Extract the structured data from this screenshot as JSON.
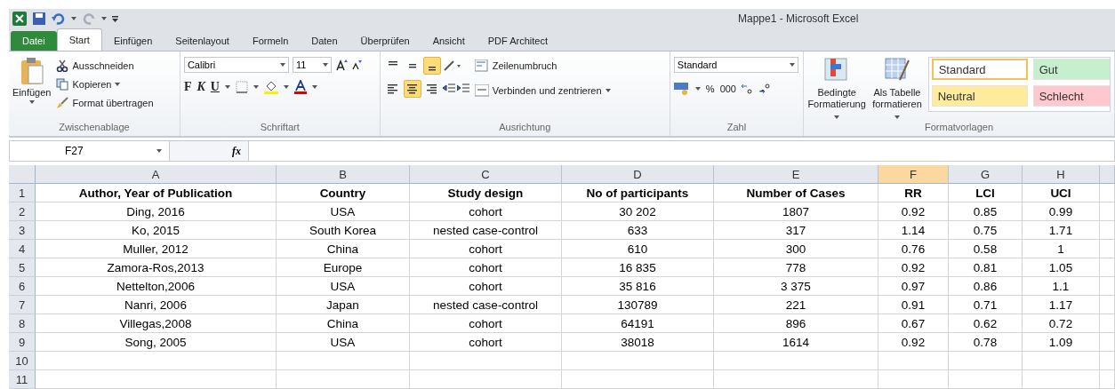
{
  "app": {
    "title": "Mappe1  -  Microsoft Excel"
  },
  "tabs": [
    {
      "label": "Datei",
      "kind": "file",
      "selected": false
    },
    {
      "label": "Start",
      "kind": "tab",
      "selected": true
    },
    {
      "label": "Einfügen",
      "kind": "tab",
      "selected": false
    },
    {
      "label": "Seitenlayout",
      "kind": "tab",
      "selected": false
    },
    {
      "label": "Formeln",
      "kind": "tab",
      "selected": false
    },
    {
      "label": "Daten",
      "kind": "tab",
      "selected": false
    },
    {
      "label": "Überprüfen",
      "kind": "tab",
      "selected": false
    },
    {
      "label": "Ansicht",
      "kind": "tab",
      "selected": false
    },
    {
      "label": "PDF Architect",
      "kind": "tab",
      "selected": false
    }
  ],
  "clipboard": {
    "paste": "Einfügen",
    "cut": "Ausschneiden",
    "copy": "Kopieren",
    "format_painter": "Format übertragen",
    "label": "Zwischenablage"
  },
  "font": {
    "name": "Calibri",
    "size": "11",
    "bold": "F",
    "italic": "K",
    "underline": "U",
    "label": "Schriftart"
  },
  "alignment": {
    "vertical": [
      {
        "selected": false
      },
      {
        "selected": false
      },
      {
        "selected": true
      }
    ],
    "horizontal": [
      {
        "selected": false
      },
      {
        "selected": true
      },
      {
        "selected": false
      }
    ],
    "wrap": "Zeilenumbruch",
    "merge": "Verbinden und zentrieren",
    "label": "Ausrichtung"
  },
  "number": {
    "format": "Standard",
    "percent": "%",
    "thousands": "000",
    "label": "Zahl"
  },
  "styles": {
    "conditional": [
      "Bedingte",
      "Formatierung"
    ],
    "as_table": [
      "Als Tabelle",
      "formatieren"
    ],
    "label": "Formatvorlagen",
    "cells": [
      {
        "label": "Standard",
        "color": "#ffffff",
        "selected": true
      },
      {
        "label": "Gut",
        "color": "#c6efce",
        "selected": false
      },
      {
        "label": "Neutral",
        "color": "#ffeb9c",
        "selected": false
      },
      {
        "label": "Schlecht",
        "color": "#ffc7ce",
        "selected": false
      }
    ]
  },
  "formula_bar": {
    "name_box": "F27",
    "fx": "fx"
  },
  "sheet": {
    "columns": [
      {
        "label": "A",
        "selected": false
      },
      {
        "label": "B",
        "selected": false
      },
      {
        "label": "C",
        "selected": false
      },
      {
        "label": "D",
        "selected": false
      },
      {
        "label": "E",
        "selected": false
      },
      {
        "label": "F",
        "selected": true
      },
      {
        "label": "G",
        "selected": false
      },
      {
        "label": "H",
        "selected": false
      }
    ],
    "rows": [
      {
        "header": "1",
        "kind": "heading",
        "cells": [
          "Author, Year of Publication",
          "Country",
          "Study design",
          "No of participants",
          "Number of Cases",
          "RR",
          "LCI",
          "UCI"
        ]
      },
      {
        "header": "2",
        "kind": "data",
        "cells": [
          "Ding, 2016",
          "USA",
          "cohort",
          "30 202",
          "1807",
          "0.92",
          "0.85",
          "0.99"
        ]
      },
      {
        "header": "3",
        "kind": "data",
        "cells": [
          "Ko, 2015",
          "South Korea",
          "nested case-control",
          "633",
          "317",
          "1.14",
          "0.75",
          "1.71"
        ]
      },
      {
        "header": "4",
        "kind": "data",
        "cells": [
          "Muller, 2012",
          "China",
          "cohort",
          "610",
          "300",
          "0.76",
          "0.58",
          "1"
        ]
      },
      {
        "header": "5",
        "kind": "data",
        "cells": [
          "Zamora-Ros,2013",
          "Europe",
          "cohort",
          "16 835",
          "778",
          "0.92",
          "0.81",
          "1.05"
        ]
      },
      {
        "header": "6",
        "kind": "data",
        "cells": [
          "Nettelton,2006",
          "USA",
          "cohort",
          "35 816",
          "3 375",
          "0.97",
          "0.86",
          "1.1"
        ]
      },
      {
        "header": "7",
        "kind": "data",
        "cells": [
          "Nanri, 2006",
          "Japan",
          "nested case-control",
          "130789",
          "221",
          "0.91",
          "0.71",
          "1.17"
        ]
      },
      {
        "header": "8",
        "kind": "data",
        "cells": [
          "Villegas,2008",
          "China",
          "cohort",
          "64191",
          "896",
          "0.67",
          "0.62",
          "0.72"
        ]
      },
      {
        "header": "9",
        "kind": "data",
        "cells": [
          "Song, 2005",
          "USA",
          "cohort",
          "38018",
          "1614",
          "0.92",
          "0.78",
          "1.09"
        ]
      },
      {
        "header": "10",
        "kind": "empty"
      },
      {
        "header": "11",
        "kind": "empty"
      }
    ]
  }
}
